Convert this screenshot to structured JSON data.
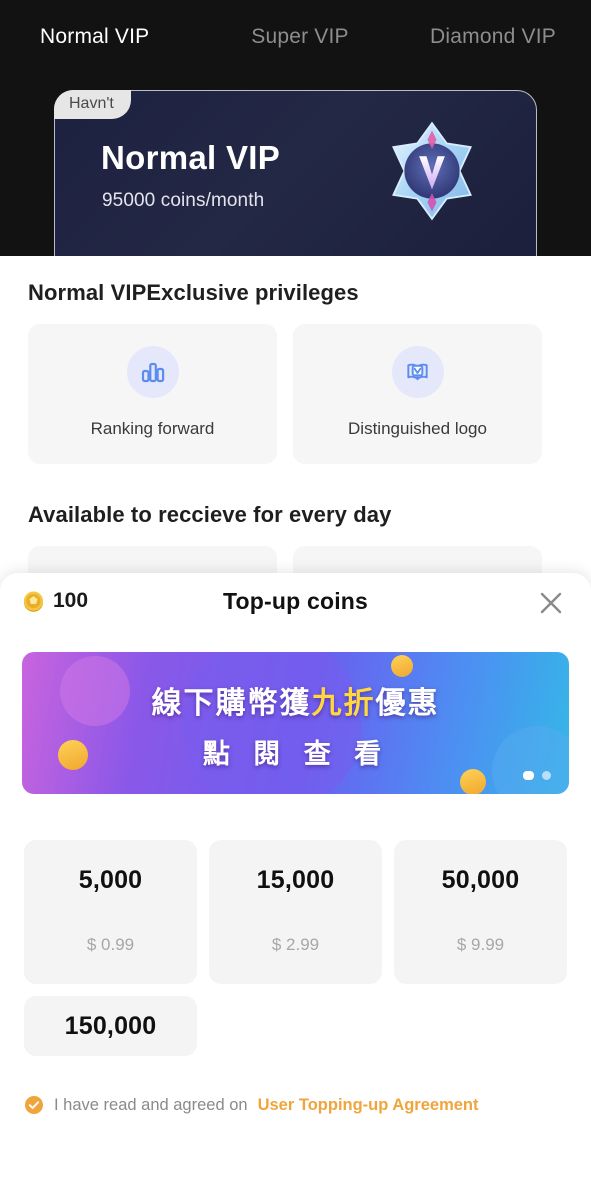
{
  "theme": {
    "header_bg": "#121212",
    "accent_orange": "#f0a53c",
    "icon_blue": "#5b8cf0",
    "card_gray": "#f4f4f4"
  },
  "header": {
    "tabs": [
      {
        "label": "Normal VIP",
        "active": true
      },
      {
        "label": "Super VIP",
        "active": false
      },
      {
        "label": "Diamond VIP",
        "active": false
      }
    ],
    "card": {
      "status_tag": "Havn't",
      "title": "Normal VIP",
      "price": "95000 coins/month",
      "badge_icon": "vip-v-badge-icon"
    }
  },
  "privileges": {
    "title": "Normal VIPExclusive privileges",
    "items": [
      {
        "label": "Ranking forward",
        "icon": "bar-chart-icon"
      },
      {
        "label": "Distinguished logo",
        "icon": "book-badge-icon"
      }
    ]
  },
  "daily": {
    "title": "Available to reccieve for every day"
  },
  "sheet": {
    "balance": "100",
    "balance_icon": "coin-icon",
    "title": "Top-up coins",
    "close_icon": "close-icon",
    "banner": {
      "line1_part1": "線下購幣獲",
      "line1_highlight": "九折",
      "line1_part2": "優惠",
      "line2": "點 閱 查 看",
      "dots": 2,
      "active_dot": 1
    },
    "packages": [
      {
        "amount": "5,000",
        "price": "$ 0.99"
      },
      {
        "amount": "15,000",
        "price": "$ 2.99"
      },
      {
        "amount": "50,000",
        "price": "$ 9.99"
      },
      {
        "amount": "150,000",
        "price": ""
      }
    ],
    "agreement": {
      "checked": true,
      "check_icon": "check-circle-icon",
      "text": "I have read and agreed on",
      "link": "User Topping-up Agreement"
    }
  }
}
